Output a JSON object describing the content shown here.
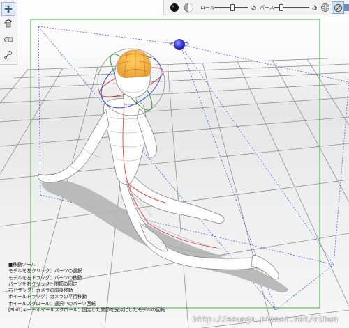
{
  "app": {
    "toolbar_left": {
      "tools": [
        {
          "name": "move-tool",
          "icon": "move-arrows-icon",
          "active": true
        },
        {
          "name": "rotate-tool",
          "icon": "rotate-box-icon",
          "active": false
        },
        {
          "name": "camera-tool",
          "icon": "camera-rotate-icon",
          "active": false
        },
        {
          "name": "pose-tool",
          "icon": "joint-pose-icon",
          "active": false
        }
      ]
    },
    "toolbar_top": {
      "roll_label": "ロール",
      "perspective_label": "パース",
      "roll_value": 0.55,
      "perspective_value": 0.2,
      "icons": [
        "black-sphere-icon",
        "shaded-sphere-icon",
        "reset-icon",
        "wireframe-icon",
        "sphere-settings-icon",
        "display-mode-icon",
        "grid-icon"
      ]
    },
    "help_text": {
      "lines": [
        "■移動ツール",
        "モデルを左クリック：パーツの選択",
        "モデルを左ドラッグ：パーツの移動",
        "パーツを右クリック：関節の固定",
        "右ドラッグ：カメラの前後移動",
        "ホイールドラッグ：カメラの平行移動",
        "ホイールスクロール：選択中のパーツ回転",
        "[Shift]キー＋ホイールスクロール：固定した関節を支点にしたモデルの回転"
      ]
    },
    "watermark": "http://asungo.pixnet.net/album",
    "colors": {
      "frame_green": "#3cb33c",
      "frustum_blue": "#4a5ad6",
      "light_sphere": "#3f43e0",
      "selection_red": "#e04040",
      "head_yellow": "#f2b93a"
    }
  }
}
